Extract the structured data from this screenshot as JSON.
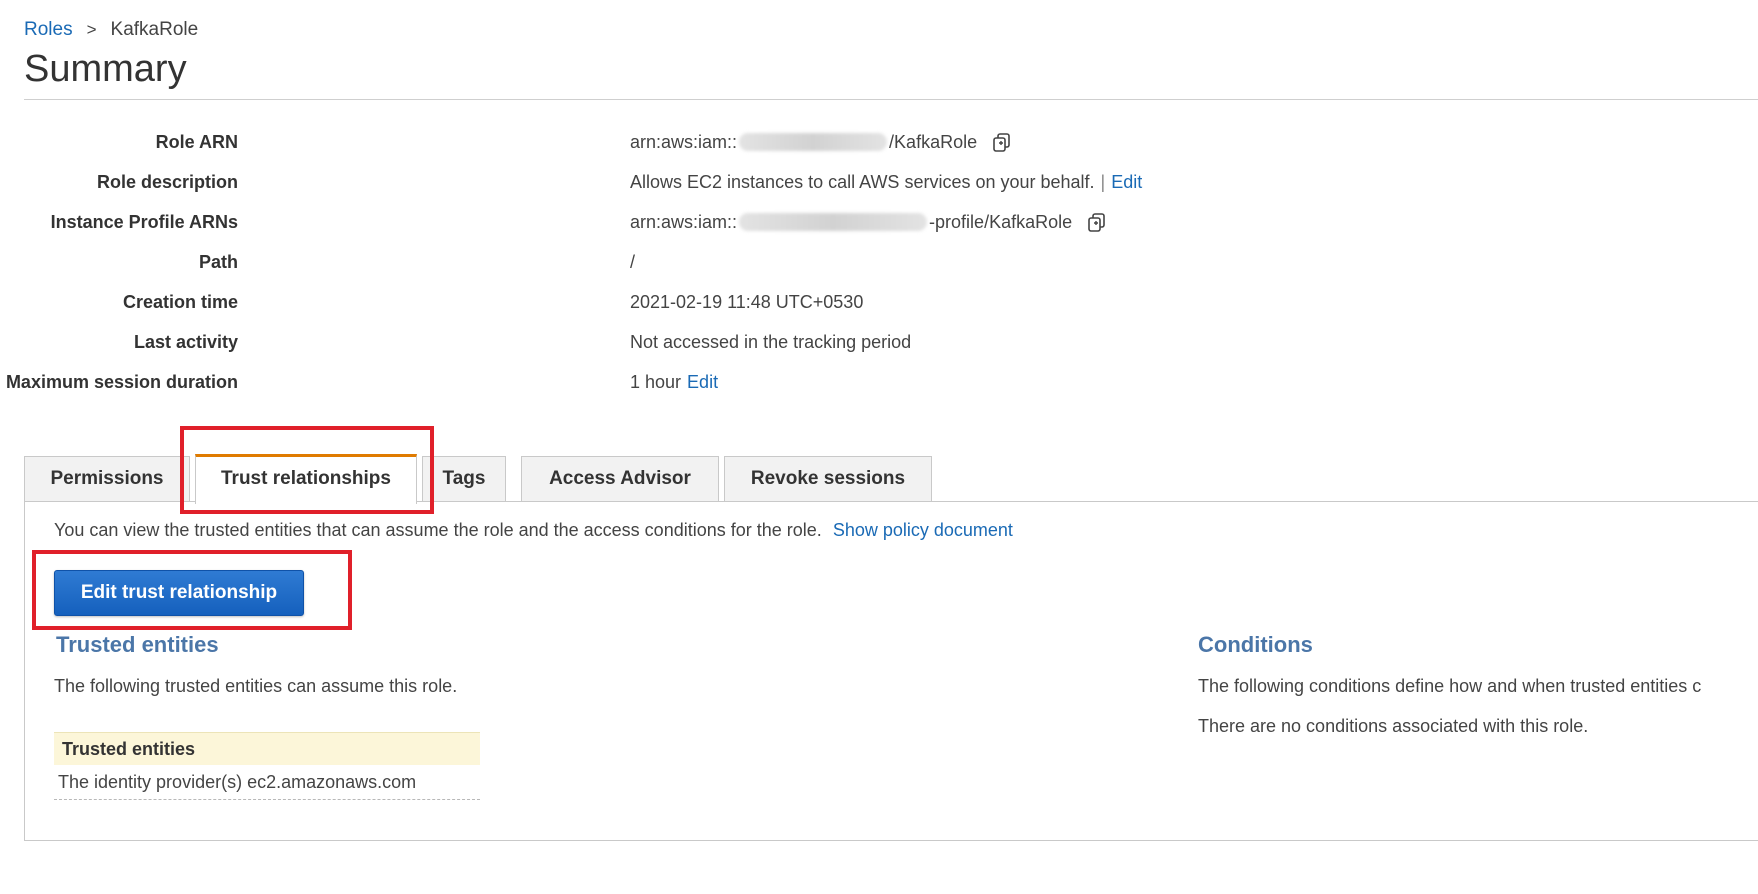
{
  "breadcrumb": {
    "parent": "Roles",
    "separator": ">",
    "current": "KafkaRole"
  },
  "page_title": "Summary",
  "summary": {
    "role_arn": {
      "label": "Role ARN",
      "prefix": "arn:aws:iam::",
      "suffix": "/KafkaRole"
    },
    "role_description": {
      "label": "Role description",
      "value": "Allows EC2 instances to call AWS services on your behalf.",
      "separator": "|",
      "edit": "Edit"
    },
    "instance_profile_arns": {
      "label": "Instance Profile ARNs",
      "prefix": "arn:aws:iam::",
      "suffix": "-profile/KafkaRole"
    },
    "path": {
      "label": "Path",
      "value": "/"
    },
    "creation_time": {
      "label": "Creation time",
      "value": "2021-02-19 11:48 UTC+0530"
    },
    "last_activity": {
      "label": "Last activity",
      "value": "Not accessed in the tracking period"
    },
    "max_session": {
      "label": "Maximum session duration",
      "value": "1 hour",
      "edit": "Edit"
    }
  },
  "tabs": [
    {
      "label": "Permissions",
      "active": false
    },
    {
      "label": "Trust relationships",
      "active": true
    },
    {
      "label": "Tags",
      "active": false
    },
    {
      "label": "Access Advisor",
      "active": false
    },
    {
      "label": "Revoke sessions",
      "active": false
    }
  ],
  "trust_panel": {
    "intro": "You can view the trusted entities that can assume the role and the access conditions for the role.",
    "show_policy_link": "Show policy document",
    "edit_button": "Edit trust relationship",
    "trusted_entities": {
      "title": "Trusted entities",
      "description": "The following trusted entities can assume this role.",
      "table_header": "Trusted entities",
      "rows": [
        "The identity provider(s) ec2.amazonaws.com"
      ]
    },
    "conditions": {
      "title": "Conditions",
      "description": "The following conditions define how and when trusted entities c",
      "empty": "There are no conditions associated with this role."
    }
  },
  "colors": {
    "link": "#1a6ab5",
    "active_tab_accent": "#e07b00",
    "highlight": "#e0202a",
    "primary_button": "#1560bd",
    "section_title": "#4b76a8"
  },
  "icons": [
    "copy-icon"
  ]
}
